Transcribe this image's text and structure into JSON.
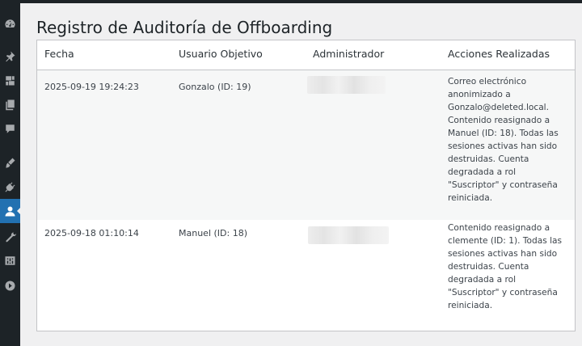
{
  "page": {
    "title": "Registro de Auditoría de Offboarding"
  },
  "sidebar": {
    "icons": [
      "dashboard-icon",
      "posts-pin-icon",
      "media-icon",
      "pages-icon",
      "comments-icon",
      "appearance-brush-icon",
      "plugins-icon",
      "users-icon",
      "tools-wrench-icon",
      "settings-icon",
      "collapse-menu-icon"
    ],
    "active": "users-icon"
  },
  "table": {
    "columns": [
      "Fecha",
      "Usuario Objetivo",
      "Administrador",
      "Acciones Realizadas"
    ],
    "rows": [
      {
        "fecha": "2025-09-19 19:24:23",
        "usuario": "Gonzalo (ID: 19)",
        "administrador": "",
        "acciones": "Correo electrónico anonimizado a Gonzalo@deleted.local. Contenido reasignado a Manuel (ID: 18). Todas las sesiones activas han sido destruidas. Cuenta degradada a rol \"Suscriptor\" y contraseña reiniciada."
      },
      {
        "fecha": "2025-09-18 01:10:14",
        "usuario": "Manuel (ID: 18)",
        "administrador": "",
        "acciones": "Contenido reasignado a clemente (ID: 1). Todas las sesiones activas han sido destruidas. Cuenta degradada a rol \"Suscriptor\" y contraseña reiniciada."
      }
    ]
  },
  "colors": {
    "sidebar_bg": "#1d2327",
    "active_menu": "#2271b1",
    "page_bg": "#f0f0f1",
    "table_border": "#c3c4c7"
  }
}
